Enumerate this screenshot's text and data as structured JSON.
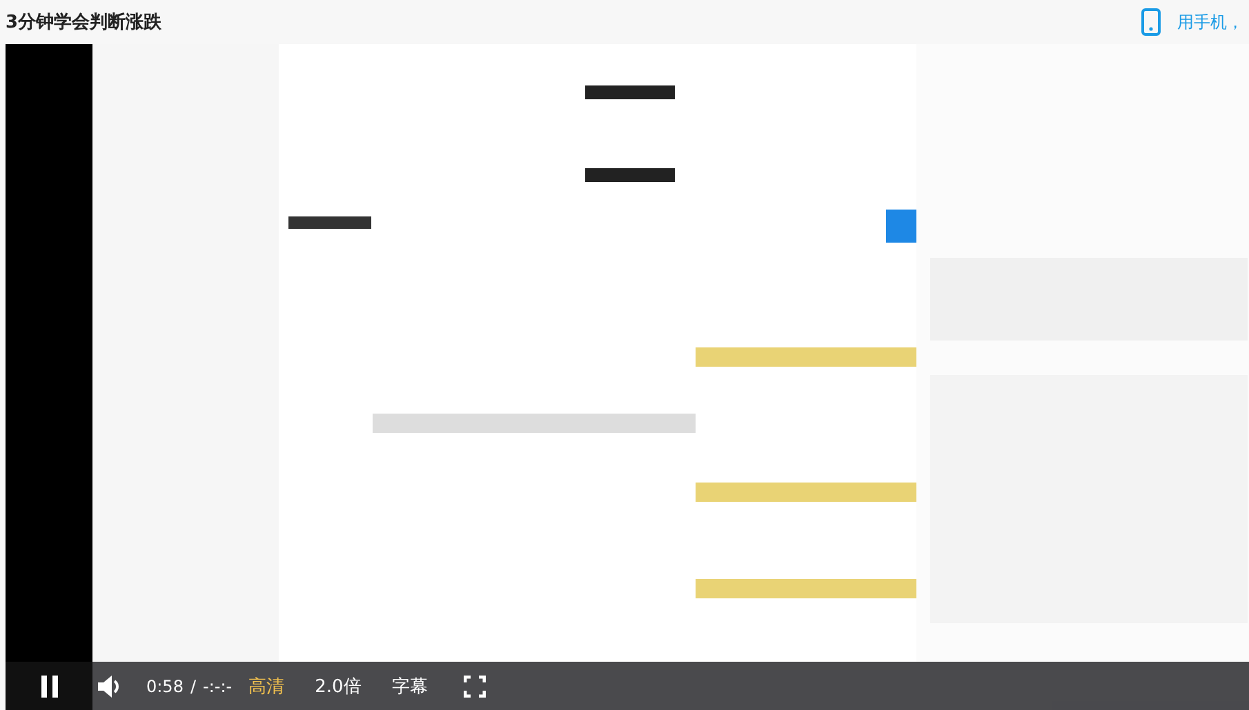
{
  "title": "3分钟学会判断涨跌",
  "mobile_link": "用手机，",
  "controls": {
    "playing": true,
    "current_time": "0:58",
    "separator": "/",
    "duration": "-:-:-",
    "options": [
      {
        "label": "高清",
        "selected": true
      },
      {
        "label": "2.0倍",
        "selected": false
      },
      {
        "label": "字幕",
        "selected": false
      }
    ]
  }
}
